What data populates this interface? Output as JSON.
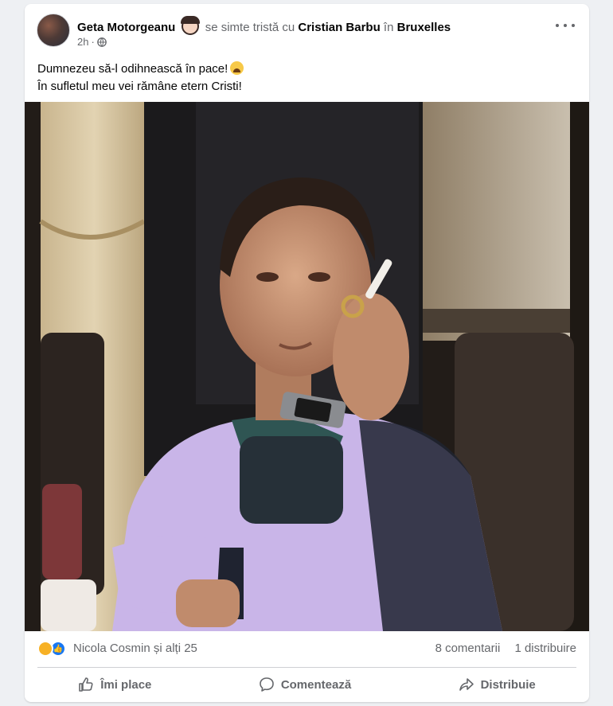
{
  "post": {
    "author": "Geta Motorgeanu",
    "feeling_text": "se simte tristă cu",
    "tagged_person": "Cristian Barbu",
    "location_prefix": "în",
    "location": "Bruxelles",
    "time": "2h",
    "separator": "·",
    "text_line1": "Dumnezeu să-l odihnească în pace!",
    "text_line2": "În sufletul meu vei rămâne etern Cristi!"
  },
  "reactions": {
    "summary": "Nicola Cosmin și alți 25",
    "comments": "8 comentarii",
    "shares": "1 distribuire"
  },
  "actions": {
    "like": "Îmi place",
    "comment": "Comentează",
    "share": "Distribuie"
  },
  "icons": {
    "feeling": "sad-face-icon",
    "privacy": "globe-icon",
    "more": "more-options-icon",
    "emoji": "crying-emoji-icon",
    "like": "thumbs-up-icon",
    "comment": "comment-bubble-icon",
    "share": "share-arrow-icon"
  },
  "colors": {
    "accent": "#1877f2",
    "muted_text": "#65676b",
    "background": "#eef0f3"
  }
}
